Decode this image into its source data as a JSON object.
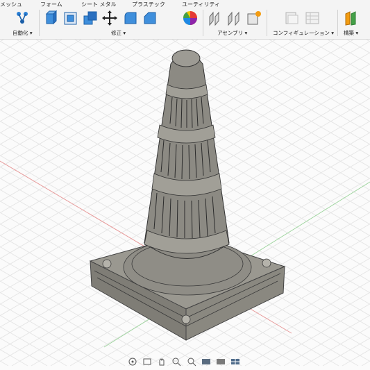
{
  "toolbar": {
    "tabs": [
      {
        "label": "メッシュ"
      },
      {
        "label": "フォーム"
      },
      {
        "label": "シート メタル"
      },
      {
        "label": "プラスチック"
      },
      {
        "label": "ユーティリティ"
      }
    ],
    "groups": [
      {
        "label": "自動化 ▾"
      },
      {
        "label": "修正 ▾"
      },
      {
        "label": "アセンブリ ▾"
      },
      {
        "label": "コンフィギュレーション ▾"
      },
      {
        "label": "構築 ▾"
      }
    ],
    "icons": [
      "automate-icon",
      "extrude-icon",
      "press-pull-icon",
      "combine-icon",
      "move-icon",
      "fillet-icon",
      "chamfer-icon",
      "appearance-icon",
      "joint-icon",
      "as-built-joint-icon",
      "new-component-icon",
      "configure-icon",
      "table-icon",
      "construct-plane-icon"
    ]
  },
  "model": {
    "name": "cone-model",
    "body_color": "#8c8a83",
    "base_color": "#9a9890"
  },
  "navigation_bar": {
    "icons": [
      "orbit-icon",
      "look-at-icon",
      "pan-icon",
      "zoom-icon",
      "zoom-window-icon",
      "display-settings-icon",
      "grid-settings-icon",
      "viewports-icon"
    ]
  },
  "colors": {
    "grid": "#e3e3e3",
    "x_axis": "#e08a8a",
    "y_axis": "#8ad08a"
  }
}
